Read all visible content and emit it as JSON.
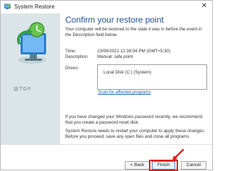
{
  "window": {
    "title": "System Restore",
    "close_label": "✕"
  },
  "page": {
    "heading": "Confirm your restore point",
    "description": "Your computer will be restored to the state it was in before the event in the Description field below."
  },
  "details": {
    "time_label": "Time:",
    "time_value": "23/09/2021 12:38:56 PM (GMT+5:30)",
    "description_label": "Description:",
    "description_value": "Manual: safe point",
    "drives_label": "Drives:",
    "drives": [
      "Local Disk (C:) (System)"
    ],
    "scan_link": "Scan for affected programs"
  },
  "notes": {
    "password": "If you have changed your Windows password recently, we recommend that you create a password reset disk.",
    "restart": "System Restore needs to restart your computer to apply these changes. Before you proceed, save any open files and close all programs."
  },
  "watermark": "@TGP",
  "buttons": {
    "back": "< Back",
    "finish": "Finish",
    "cancel": "Cancel"
  },
  "colors": {
    "heading": "#1d4f91",
    "accent": "#e31b1b",
    "panel": "#dbe5e8"
  }
}
